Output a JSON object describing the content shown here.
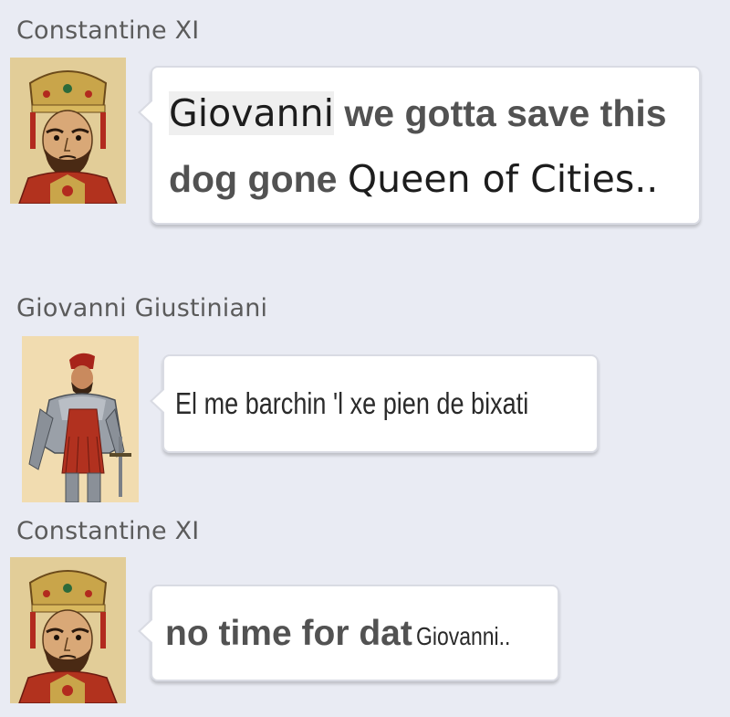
{
  "messages": [
    {
      "sender": "Constantine XI",
      "avatar_icon": "emperor-portrait-icon",
      "text": {
        "line1_a": "Giovanni",
        "line1_b": "we gotta save this",
        "line2_a": "dog gone",
        "line2_b": "Queen of Cities.."
      }
    },
    {
      "sender": "Giovanni Giustiniani",
      "avatar_icon": "armored-knight-portrait-icon",
      "text": {
        "line1": "El me barchin 'l xe pien de bixati"
      }
    },
    {
      "sender": "Constantine XI",
      "avatar_icon": "emperor-portrait-icon",
      "text": {
        "line1_a": "no time for dat",
        "line1_b": "Giovanni.."
      }
    }
  ],
  "colors": {
    "background": "#e9ebf3",
    "bubble": "#ffffff",
    "sender_text": "#5b5b5b"
  }
}
